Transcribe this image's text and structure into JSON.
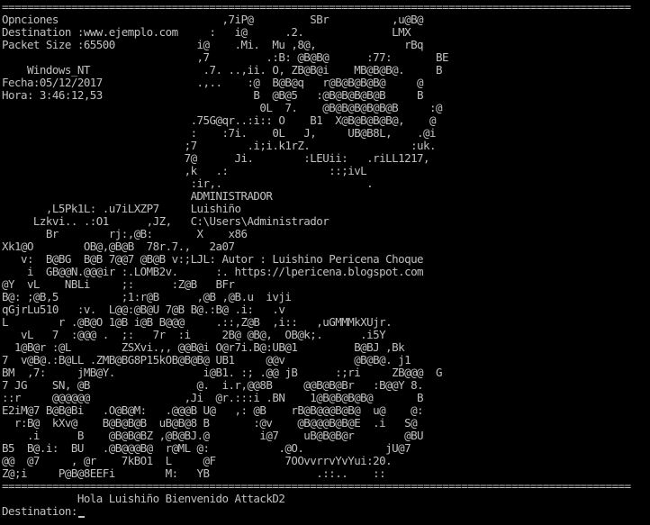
{
  "console": {
    "colors": {
      "background": "#000000",
      "text": "#c0c0c0"
    },
    "lines": [
      "====================================================================================================",
      "Opnciones                          ,7iP@         SBr          ,u@B@",
      "Destination :www.ejemplo.com     :   i@      .2.              LMX",
      "Packet Size :65500             i@    .Mi.  Mu ,8@,              rBq",
      "                               ,7         .:B: @B@B@      :77:       BE",
      "    Windows_NT                  .7. ..,ii. O, ZB@B@i    MB@B@B@.     B",
      "Fecha:05/12/2017               .,..    :@  B@B@q   r@B@B@B@B@     @",
      "Hora: 3:46:12,53                        B  @B@5   :@B@B@B@B@B     B",
      "                                         0L  7.    @B@B@B@B@B@B     :@",
      "                              .75G@qr..:i:: O    B1  X@B@B@B@B@,    @",
      "                              :    :7i.    0L   J,     UB@B8L,    .@i",
      "                             ;7        .i;i.k1rZ.                :uk.",
      "                             7@      Ji.        :LEUii:   .riLL1217,",
      "                             ,k   .:                ::;ivL",
      "                              :ir,.                       .",
      "                              ADMINISTRADOR",
      "       ,L5Pk1L: .u7iLXZP7     Luishiño",
      "     Lzkvi.. .:O1      ,JZ,   C:\\Users\\Administrador",
      "       Br        rj:,@B:       X    x86",
      "Xk1@O        OB@,@B@B  78r.7.,   2a07",
      "   v:  B@BG  B@B 7@@7 @B@B v:;LJL: Autor : Luishino Pericena Choque",
      "    i  GB@@N.@@@ir :.LOMB2v.      :. https://lpericena.blogspot.com",
      "@Y  vL    NBLi     ;:      :Z@B   BFr",
      "B@: ;@B,5          ;1:r@B      ,@B ,@B.u  ivji",
      "qGjrLu510   :v.  L@@:@B@U 7@B B@.:B@ .i:   .v",
      "L        r .@B@O 1@B i@B B@@@     .::,Z@B  ,i::   ,uGMMMkXUjr.",
      "   vL   7  :@@@ .  ;:   7r  :i     2B@ @B@,  OB@k;.      .i5Y",
      "  1@B@r :@L        ZSXvi.,, @@B@i O@r7i.B@:UB@1         B@BJ ,Bk",
      "7  v@B@.:B@LL .ZMB@BG8P15kOB@B@B@ UB1     @@v           @B@B@. j1",
      "BM  ,7:     jMB@Y.              i@B1. :; .@@ jB      :;ri     ZB@@@  G",
      "7 JG    SN, @B                 @.  i.r,@@8B     @@B@B@Br   :B@@Y 8.",
      "::r     @@@@@@               ,Ji  @r.:::i .BN    1@B@B@B@B@       B",
      "E2iM@7 B@B@Bi   .O@B@M:   .@@@B U@   ,: @B    rB@B@@@B@B@  u@    @:",
      "  r:B@  kXv@    B@B@B@B  uB@B@8 B       :@v    @B@@@B@B@E  .i   S@",
      "    .i      B    @B@B@BZ ,@B@BJ.@        i@7    uB@B@B@r        @BU",
      "B5  B@.i:  BU   .@B@@@B@  r@ML @:           .@O.             jU@7",
      "@@  @7     , @r    7kBO1  L     @F           7OOvvrrvYvYui:20.",
      "Z@;i     P@B@8EEFi        M:   YB                 .::..    ::",
      "====================================================================================================",
      "            Hola Luishiño Bienvenido AttackD2"
    ],
    "prompt": "Destination:"
  }
}
